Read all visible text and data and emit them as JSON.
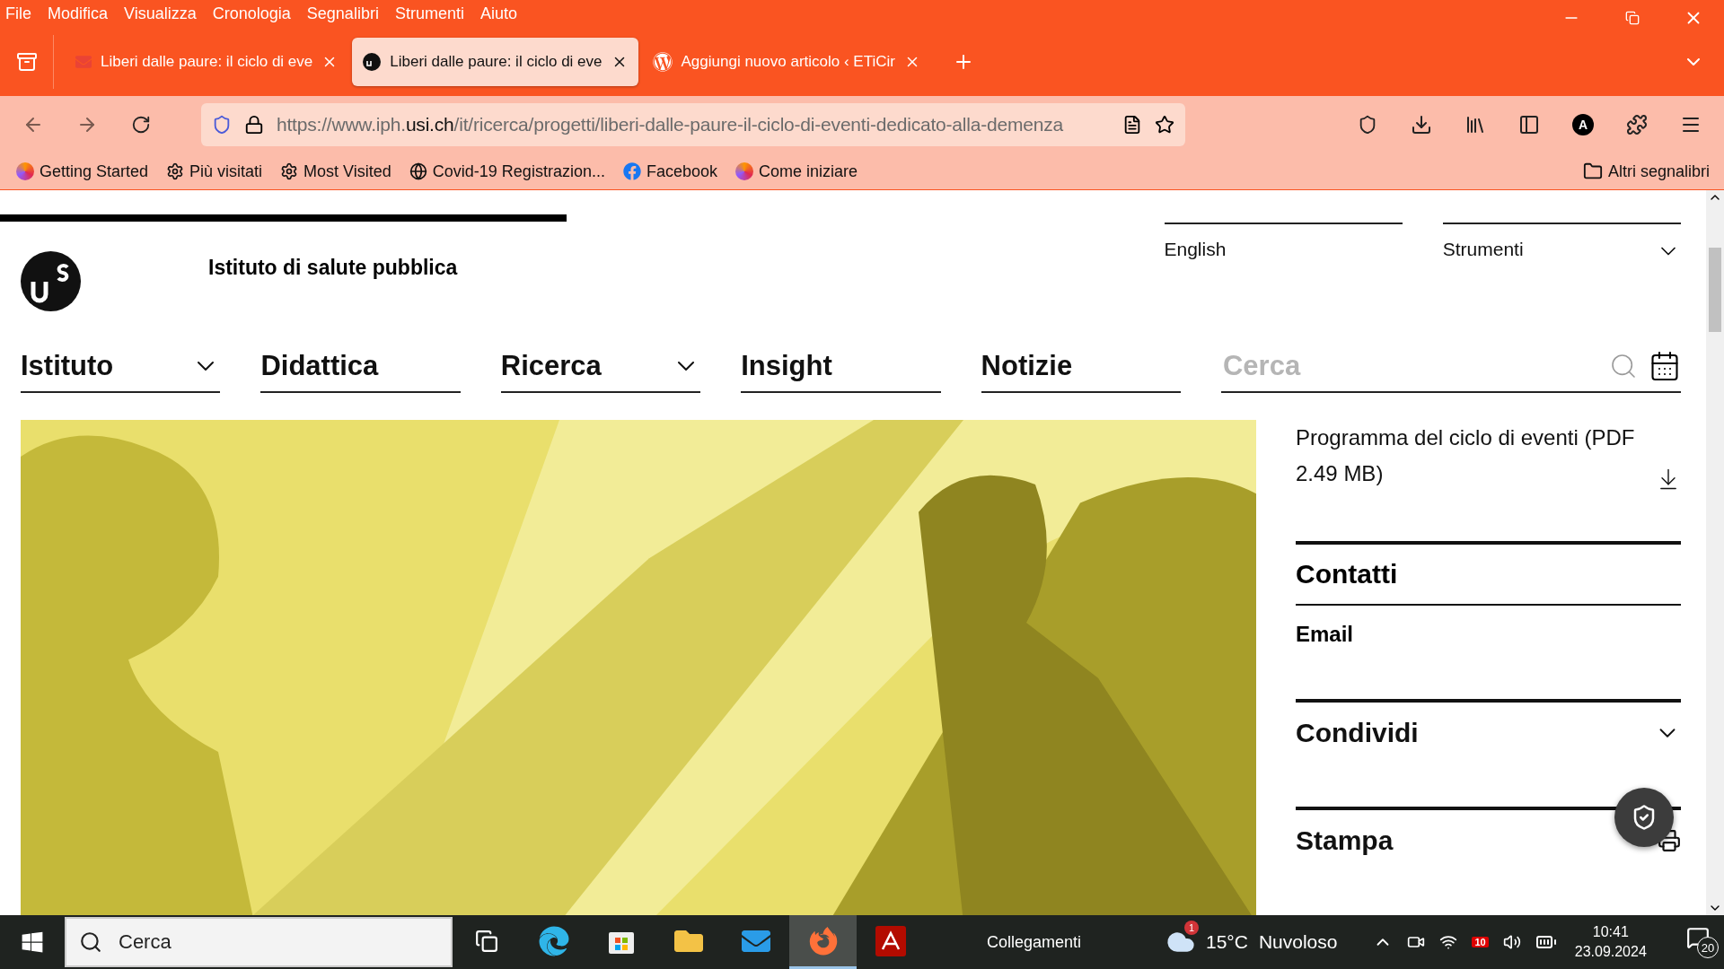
{
  "menu": [
    "File",
    "Modifica",
    "Visualizza",
    "Cronologia",
    "Segnalibri",
    "Strumenti",
    "Aiuto"
  ],
  "tabs": [
    {
      "title": "Liberi dalle paure: il ciclo di eve",
      "selected": false
    },
    {
      "title": "Liberi dalle paure: il ciclo di eve",
      "selected": true
    },
    {
      "title": "Aggiungi nuovo articolo ‹ ETiCir",
      "selected": false
    }
  ],
  "url": {
    "prefix": "https://www.iph.",
    "domain": "usi.ch",
    "path": "/it/ricerca/progetti/liberi-dalle-paure-il-ciclo-di-eventi-dedicato-alla-demenza"
  },
  "bookmarks": [
    "Getting Started",
    "Più visitati",
    "Most Visited",
    "Covid-19 Registrazion...",
    "Facebook",
    "Come iniziare"
  ],
  "account_initial": "A",
  "other_bookmarks": "Altri segnalibri",
  "site": {
    "title": "Istituto di salute pubblica",
    "language": "English",
    "tools": "Strumenti"
  },
  "nav": [
    {
      "label": "Istituto",
      "dropdown": true
    },
    {
      "label": "Didattica",
      "dropdown": false
    },
    {
      "label": "Ricerca",
      "dropdown": true
    },
    {
      "label": "Insight",
      "dropdown": false
    },
    {
      "label": "Notizie",
      "dropdown": false
    }
  ],
  "search": {
    "placeholder": "Cerca"
  },
  "sidebar": {
    "download": "Programma del ciclo di eventi (PDF 2.49 MB)",
    "contacts_heading": "Contatti",
    "email_label": "Email",
    "share": "Condividi",
    "print": "Stampa"
  },
  "taskbar": {
    "search_placeholder": "Cerca",
    "apps": [
      {
        "selected": false
      },
      {
        "selected": false
      },
      {
        "selected": false
      },
      {
        "selected": false
      },
      {
        "selected": false
      },
      {
        "selected": true
      },
      {
        "selected": false
      }
    ],
    "links": "Collegamenti",
    "weather_badge": "1",
    "temperature": "15°C",
    "weather": "Nuvoloso",
    "tray_badge": "10",
    "time": "10:41",
    "date": "23.09.2024",
    "notifications": "20"
  }
}
